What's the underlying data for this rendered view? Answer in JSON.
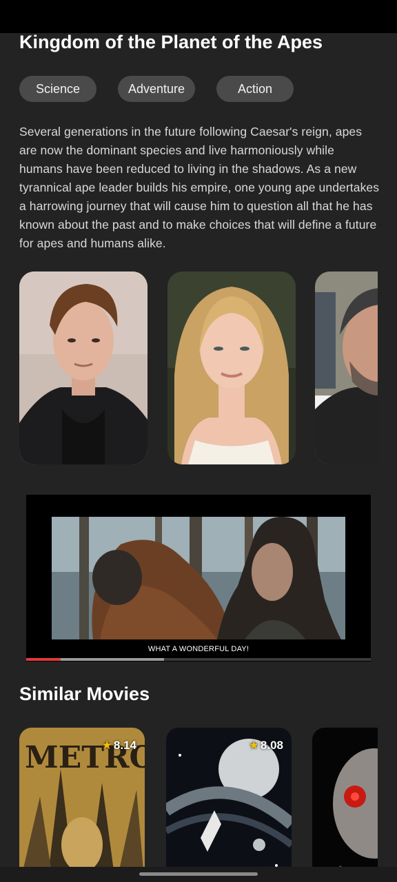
{
  "movie": {
    "title": "Kingdom of the Planet of the Apes",
    "genres": [
      "Science",
      "Adventure",
      "Action"
    ],
    "overview": "Several generations in the future following Caesar's reign, apes are now the dominant species and live harmoniously while humans have been reduced to living in the shadows. As a new tyrannical ape leader builds his empire, one young ape undertakes a harrowing journey that will cause him to question all that he has known about the past and to make choices that will define a future for apes and humans alike."
  },
  "player": {
    "subtitle": "WHAT A WONDERFUL DAY!",
    "played_fraction": 0.1,
    "buffered_fraction": 0.4
  },
  "similar": {
    "heading": "Similar Movies",
    "movies": [
      {
        "rating": "8.14"
      },
      {
        "rating": "8.08"
      }
    ]
  },
  "colors": {
    "background": "#232323",
    "chip": "#4a4a4a",
    "progress_played": "#e53935",
    "star": "#f2c200"
  }
}
